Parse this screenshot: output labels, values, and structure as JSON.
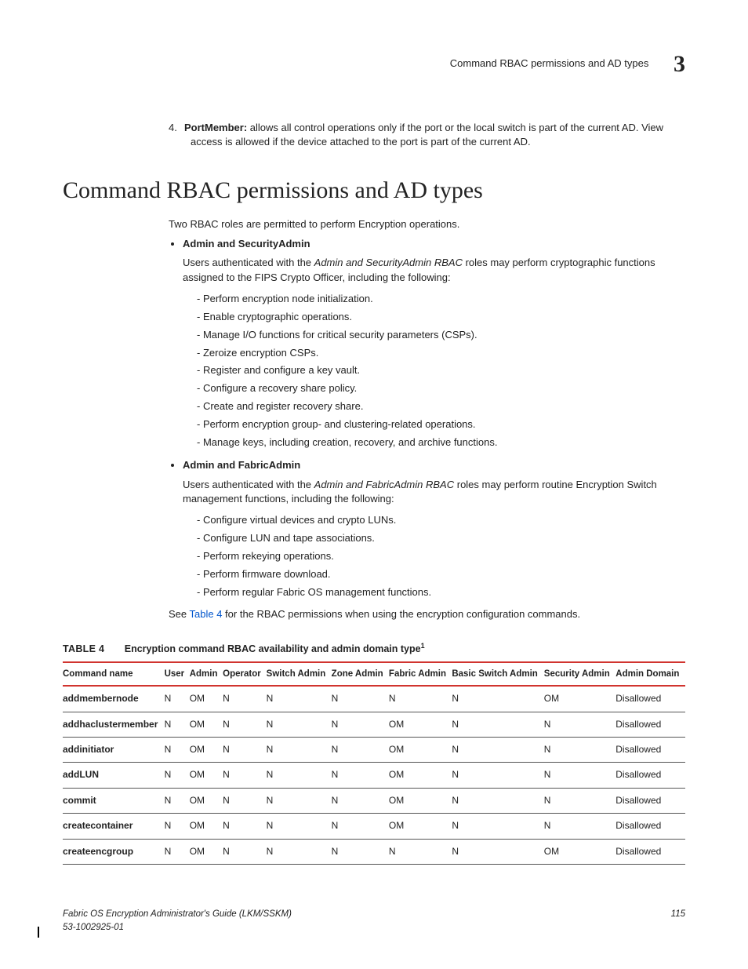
{
  "header": {
    "title": "Command RBAC permissions and AD types",
    "chapter": "3"
  },
  "lead": {
    "num": "4.",
    "term": "PortMember:",
    "text": " allows all control operations only if the port or the local switch is part of the current AD. View access is allowed if the device attached to the port is part of the current AD."
  },
  "section_title": "Command RBAC permissions and AD types",
  "intro": "Two RBAC roles are permitted to perform Encryption operations.",
  "roles": [
    {
      "heading": "Admin and SecurityAdmin",
      "para_pre": "Users authenticated with the ",
      "para_em": "Admin and SecurityAdmin RBAC",
      "para_post": " roles may perform cryptographic functions assigned to the FIPS Crypto Officer, including the following:",
      "items": [
        "Perform encryption node initialization.",
        "Enable cryptographic operations.",
        "Manage I/O functions for critical security parameters (CSPs).",
        "Zeroize encryption CSPs.",
        "Register and configure a key vault.",
        "Configure a recovery share policy.",
        "Create and register recovery share.",
        "Perform encryption group- and clustering-related operations.",
        "Manage keys, including creation, recovery, and archive functions."
      ]
    },
    {
      "heading": "Admin and FabricAdmin",
      "para_pre": "Users authenticated with the ",
      "para_em": "Admin and FabricAdmin RBAC",
      "para_post": " roles may perform routine Encryption Switch management functions, including the following:",
      "items": [
        "Configure virtual devices and crypto LUNs.",
        "Configure LUN and tape associations.",
        "Perform rekeying operations.",
        "Perform firmware download.",
        "Perform regular Fabric OS management functions."
      ]
    }
  ],
  "see_pre": "See ",
  "see_link": "Table 4",
  "see_post": " for the RBAC permissions when using the encryption configuration commands.",
  "table": {
    "label": "TABLE 4",
    "caption": "Encryption command RBAC availability and admin domain type",
    "sup": "1",
    "headers": [
      "Command name",
      "User",
      "Admin",
      "Operator",
      "Switch Admin",
      "Zone Admin",
      "Fabric Admin",
      "Basic Switch Admin",
      "Security Admin",
      "Admin Domain"
    ],
    "rows": [
      [
        "addmembernode",
        "N",
        "OM",
        "N",
        "N",
        "N",
        "N",
        "N",
        "OM",
        "Disallowed"
      ],
      [
        "addhaclustermember",
        "N",
        "OM",
        "N",
        "N",
        "N",
        "OM",
        "N",
        "N",
        "Disallowed"
      ],
      [
        "addinitiator",
        "N",
        "OM",
        "N",
        "N",
        "N",
        "OM",
        "N",
        "N",
        "Disallowed"
      ],
      [
        "addLUN",
        "N",
        "OM",
        "N",
        "N",
        "N",
        "OM",
        "N",
        "N",
        "Disallowed"
      ],
      [
        "commit",
        "N",
        "OM",
        "N",
        "N",
        "N",
        "OM",
        "N",
        "N",
        "Disallowed"
      ],
      [
        "createcontainer",
        "N",
        "OM",
        "N",
        "N",
        "N",
        "OM",
        "N",
        "N",
        "Disallowed"
      ],
      [
        "createencgroup",
        "N",
        "OM",
        "N",
        "N",
        "N",
        "N",
        "N",
        "OM",
        "Disallowed"
      ]
    ]
  },
  "footer": {
    "book": "Fabric OS Encryption Administrator's Guide  (LKM/SSKM)",
    "docnum": "53-1002925-01",
    "page": "115"
  }
}
